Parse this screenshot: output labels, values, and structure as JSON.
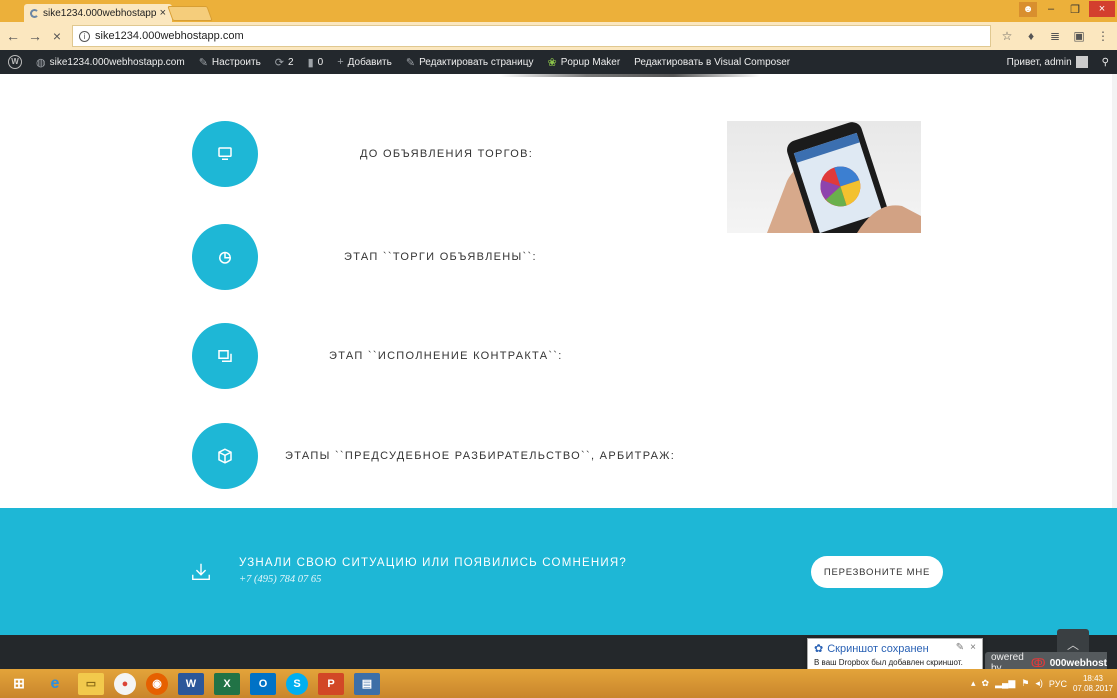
{
  "browser": {
    "tab_title": "sike1234.000webhostapp",
    "tab_close": "×",
    "url": "sike1234.000webhostapp.com",
    "back": "←",
    "forward": "→",
    "reload": "×",
    "window_minimize": "–",
    "window_restore": "❐",
    "window_close": "×"
  },
  "adminbar": {
    "site": "sike1234.000webhostapp.com",
    "customize": "Настроить",
    "updates": "2",
    "comments": "0",
    "add_new": "Добавить",
    "edit_page": "Редактировать страницу",
    "popup_maker": "Popup Maker",
    "visual_composer": "Редактировать в Visual Composer",
    "greeting": "Привет, admin"
  },
  "steps": [
    {
      "label": "ДО ОБЪЯВЛЕНИЯ ТОРГОВ:",
      "icon": "monitor-icon"
    },
    {
      "label": "ЭТАП ``ТОРГИ ОБЪЯВЛЕНЫ``:",
      "icon": "pie-chart-icon"
    },
    {
      "label": "ЭТАП ``ИСПОЛНЕНИЕ КОНТРАКТА``:",
      "icon": "copy-icon"
    },
    {
      "label": "ЭТАПЫ ``ПРЕДСУДЕБНОЕ РАЗБИРАТЕЛЬСТВО``, АРБИТРАЖ:",
      "icon": "box-icon"
    }
  ],
  "cta": {
    "title": "УЗНАЛИ СВОЮ СИТУАЦИЮ ИЛИ ПОЯВИЛИСЬ СОМНЕНИЯ?",
    "phone": "+7 (495) 784 07 65",
    "button": "ПЕРЕЗВОНИТЕ МНЕ"
  },
  "powered": {
    "prefix": "owered by",
    "brand": "000webhost"
  },
  "toast": {
    "title": "Скриншот сохранен",
    "body": "В ваш Dropbox был добавлен скриншот."
  },
  "tray": {
    "language": "РУС",
    "time": "18:43",
    "date": "07.08.2017"
  },
  "colors": {
    "accent": "#1eb7d6",
    "adminbar": "#23282d",
    "taskbar": "#d9962f"
  }
}
